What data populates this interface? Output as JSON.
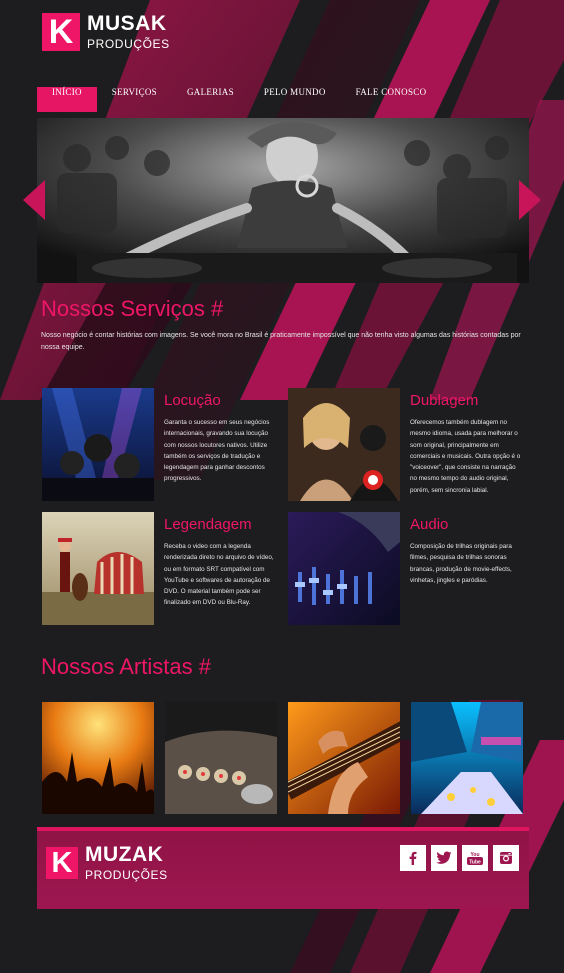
{
  "logo": {
    "letter": "K",
    "line1": "MUSAK",
    "line2": "PRODUÇÕES"
  },
  "nav": {
    "items": [
      {
        "label": "INÍCIO"
      },
      {
        "label": "SERVIÇOS"
      },
      {
        "label": "GALERIAS"
      },
      {
        "label": "PELO MUNDO"
      },
      {
        "label": "FALE CONOSCO"
      }
    ],
    "active_index": 0
  },
  "services_section": {
    "title": "Nossos Serviços #",
    "intro": "Nosso negócio é contar histórias com imagens. Se você mora no Brasil é praticamente impossível que não tenha visto algumas das histórias contadas por nossa equipe."
  },
  "services": [
    {
      "title": "Locução",
      "text": "Garanta o sucesso em seus negócios internacionais, gravando sua locução com nossos locutores nativos. Utilize também os serviços de tradução e legendagem para ganhar descontos progressivos."
    },
    {
      "title": "Dublagem",
      "text": "Oferecemos também dublagem no mesmo idioma, usada para melhorar o som original, principalmente em comerciais e musicais. Outra opção é o \"voiceover\", que consiste na narração no mesmo tempo do audio original, porém, sem sincronia labial."
    },
    {
      "title": "Legendagem",
      "text": "Receba o video com a legenda renderizada direto no arquivo de vídeo, ou em formato SRT compatível com YouTube e softwares de autoração de DVD.  O material também pode ser finalizado em DVD ou Blu-Ray."
    },
    {
      "title": "Audio",
      "text": "Composição de trilhas originais para filmes, pesquisa de trilhas sonoras brancas, produção de movie-effects, vinhetas, jingles e paródias."
    }
  ],
  "artists_section": {
    "title": "Nossos Artistas #"
  },
  "footer": {
    "logo": {
      "letter": "K",
      "line1": "MUZAK",
      "line2": "PRODUÇÕES"
    },
    "socials": [
      "facebook-icon",
      "twitter-icon",
      "youtube-icon",
      "instagram-icon"
    ]
  },
  "colors": {
    "accent": "#ef1667",
    "background": "#1d1d1f",
    "footer": "#9e1650"
  }
}
